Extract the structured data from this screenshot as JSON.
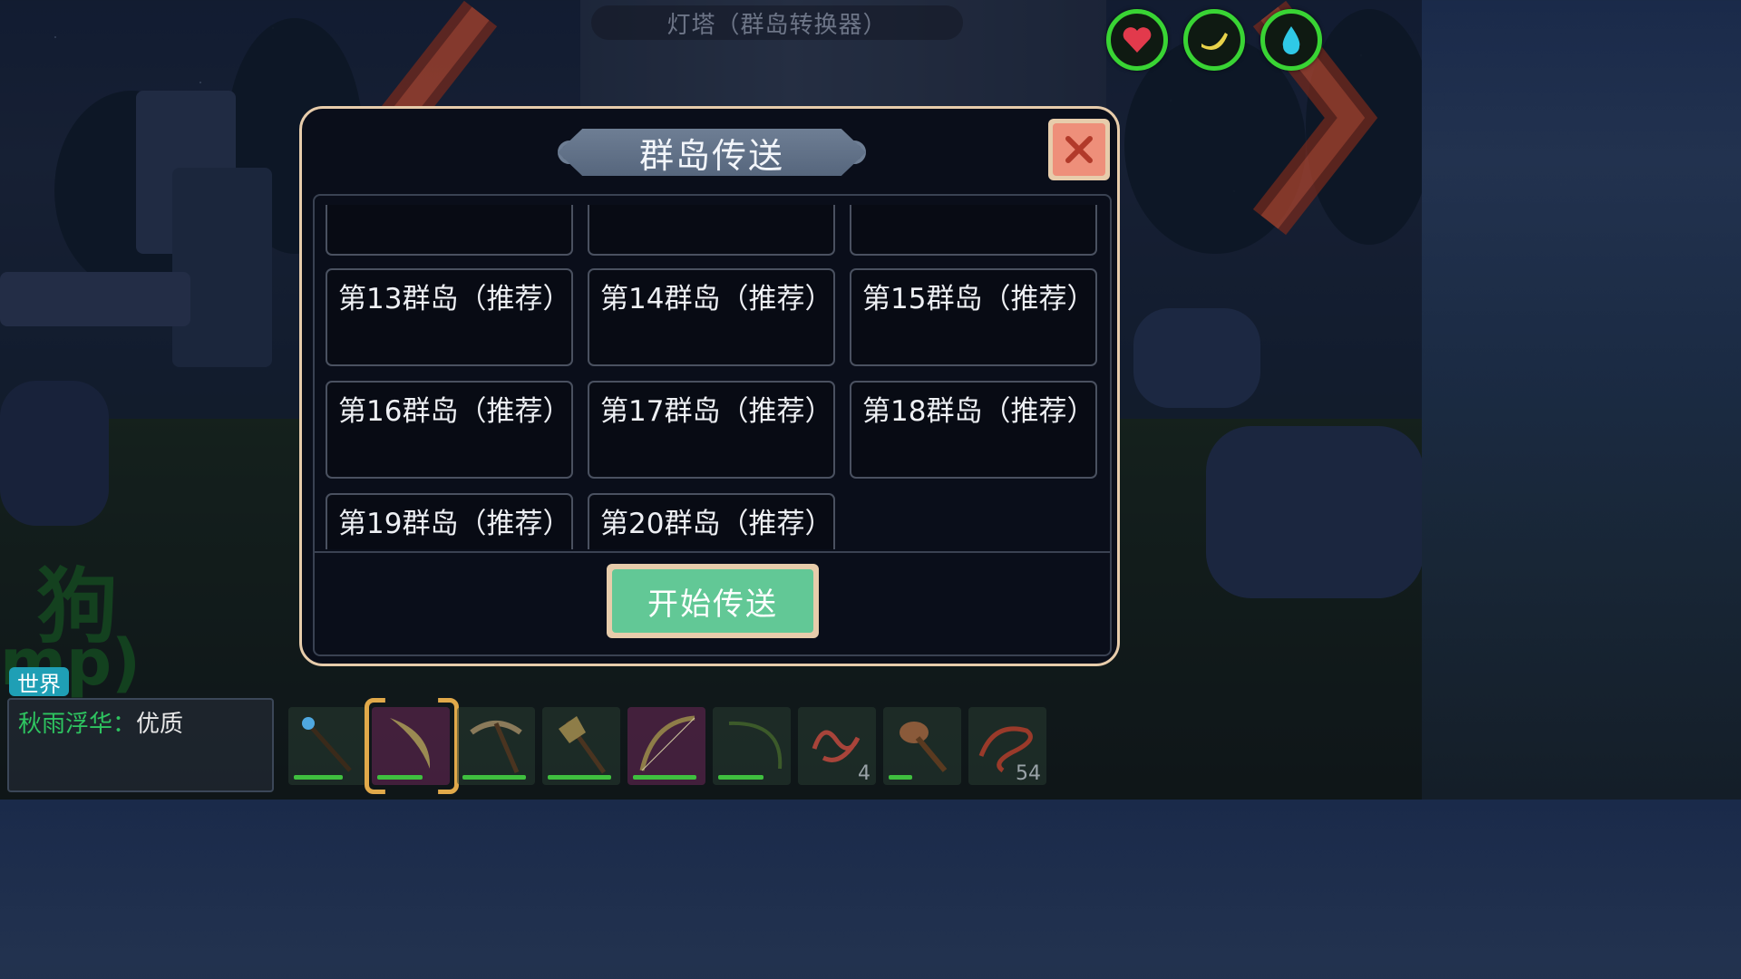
{
  "top_title": "灯塔（群岛转换器）",
  "modal": {
    "title": "群岛传送",
    "start_label": "开始传送",
    "islands": [
      {
        "label": ""
      },
      {
        "label": ""
      },
      {
        "label": ""
      },
      {
        "label": "第13群岛（推荐）"
      },
      {
        "label": "第14群岛（推荐）"
      },
      {
        "label": "第15群岛（推荐）"
      },
      {
        "label": "第16群岛（推荐）"
      },
      {
        "label": "第17群岛（推荐）"
      },
      {
        "label": "第18群岛（推荐）"
      },
      {
        "label": "第19群岛（推荐）"
      },
      {
        "label": "第20群岛（推荐）"
      }
    ]
  },
  "stats": [
    {
      "icon": "heart-icon",
      "color": "#e23a4c"
    },
    {
      "icon": "banana-icon",
      "color": "#e8d24a"
    },
    {
      "icon": "water-drop-icon",
      "color": "#2fc9e6"
    }
  ],
  "chat": {
    "channel": "世界",
    "name": "秋雨浮华：",
    "message": "优质"
  },
  "background_text": [
    "狗",
    "mp)"
  ],
  "hotbar": [
    {
      "icon": "magic-staff-icon",
      "count": "",
      "selected": false
    },
    {
      "icon": "scythe-blade-icon",
      "count": "",
      "selected": true
    },
    {
      "icon": "pickaxe-icon",
      "count": "",
      "selected": false
    },
    {
      "icon": "battle-axe-icon",
      "count": "",
      "selected": false
    },
    {
      "icon": "longbow-icon",
      "count": "",
      "selected": false
    },
    {
      "icon": "fishing-rod-icon",
      "count": "",
      "selected": false
    },
    {
      "icon": "worm-bait-icon",
      "count": "4",
      "selected": false
    },
    {
      "icon": "club-icon",
      "count": "",
      "selected": false
    },
    {
      "icon": "rope-icon",
      "count": "54",
      "selected": false
    }
  ]
}
